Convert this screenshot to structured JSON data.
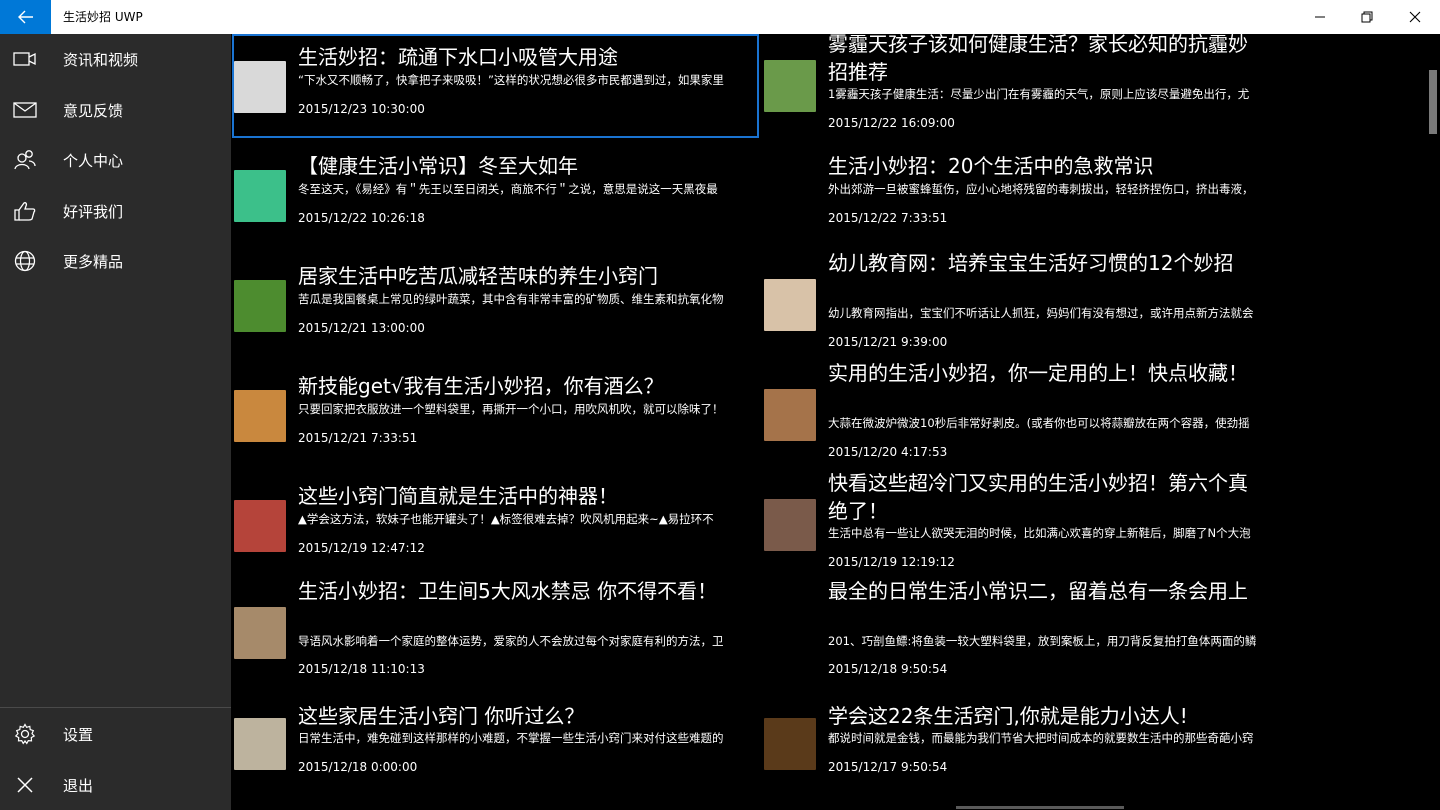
{
  "window": {
    "title": "生活妙招 UWP",
    "back_icon": "arrow-left-icon",
    "minimize_icon": "minimize-icon",
    "restore_icon": "restore-icon",
    "close_icon": "close-icon"
  },
  "sidebar": {
    "items": [
      {
        "label": "资讯和视频",
        "icon": "video-camera-icon"
      },
      {
        "label": "意见反馈",
        "icon": "mail-icon"
      },
      {
        "label": "个人中心",
        "icon": "people-icon"
      },
      {
        "label": "好评我们",
        "icon": "thumbs-up-icon"
      },
      {
        "label": "更多精品",
        "icon": "globe-icon"
      }
    ],
    "bottom_items": [
      {
        "label": "设置",
        "icon": "gear-icon"
      },
      {
        "label": "退出",
        "icon": "close-icon"
      }
    ]
  },
  "articles_left": [
    {
      "title": "生活妙招：疏通下水口小吸管大用途",
      "summary": "“下水又不顺畅了，快拿把子来吸吸！”这样的状况想必很多市民都遇到过，如果家里",
      "date": "2015/12/23 10:30:00",
      "thumb_color": "#d9d9d9"
    },
    {
      "title": "【健康生活小常识】冬至大如年",
      "summary": "冬至这天，《易经》有＂先王以至日闭关，商旅不行＂之说，意思是说这一天黑夜最",
      "date": "2015/12/22 10:26:18",
      "thumb_color": "#3cc08a"
    },
    {
      "title": "居家生活中吃苦瓜减轻苦味的养生小窍门",
      "summary": "苦瓜是我国餐桌上常见的绿叶蔬菜，其中含有非常丰富的矿物质、维生素和抗氧化物",
      "date": "2015/12/21 13:00:00",
      "thumb_color": "#4d8c2f"
    },
    {
      "title": "新技能get√我有生活小妙招，你有酒么？",
      "summary": "只要回家把衣服放进一个塑料袋里，再撕开一个小口，用吹风机吹，就可以除味了！",
      "date": "2015/12/21 7:33:51",
      "thumb_color": "#c9883e"
    },
    {
      "title": "这些小窍门简直就是生活中的神器！",
      "summary": "▲学会这方法，软妹子也能开罐头了！▲标签很难去掉？吹风机用起来~▲易拉环不",
      "date": "2015/12/19 12:47:12",
      "thumb_color": "#b5443a"
    },
    {
      "title": "生活小妙招：卫生间5大风水禁忌 你不得不看！",
      "summary": "导语风水影响着一个家庭的整体运势，爱家的人不会放过每个对家庭有利的方法，卫",
      "date": "2015/12/18 11:10:13",
      "thumb_color": "#a68a6a"
    },
    {
      "title": "这些家居生活小窍门 你听过么？",
      "summary": "日常生活中，难免碰到这样那样的小难题，不掌握一些生活小窍门来对付这些难题的",
      "date": "2015/12/18 0:00:00",
      "thumb_color": "#bdb39e"
    }
  ],
  "articles_right": [
    {
      "title": "雾霾天孩子该如何健康生活？家长必知的抗霾妙招推荐",
      "summary": "1雾霾天孩子健康生活：尽量少出门在有雾霾的天气，原则上应该尽量避免出行，尤",
      "date": "2015/12/22 16:09:00",
      "thumb_color": "#6a9a4a"
    },
    {
      "title": "生活小妙招：20个生活中的急救常识",
      "summary": "外出郊游一旦被蜜蜂蜇伤，应小心地将残留的毒刺拔出，轻轻挤捏伤口，挤出毒液，",
      "date": "2015/12/22 7:33:51",
      "thumb_color": "#000000"
    },
    {
      "title": "幼儿教育网：培养宝宝生活好习惯的12个妙招",
      "summary": "幼儿教育网指出，宝宝们不听话让人抓狂，妈妈们有没有想过，或许用点新方法就会",
      "date": "2015/12/21 9:39:00",
      "thumb_color": "#d8c2a8"
    },
    {
      "title": "实用的生活小妙招，你一定用的上！快点收藏！",
      "summary": "大蒜在微波炉微波10秒后非常好剥皮。(或者你也可以将蒜瓣放在两个容器，使劲摇",
      "date": "2015/12/20 4:17:53",
      "thumb_color": "#a5734a"
    },
    {
      "title": "快看这些超冷门又实用的生活小妙招！第六个真绝了！",
      "summary": "生活中总有一些让人欲哭无泪的时候，比如满心欢喜的穿上新鞋后，脚磨了N个大泡",
      "date": "2015/12/19 12:19:12",
      "thumb_color": "#7a5a4a"
    },
    {
      "title": "最全的日常生活小常识二，留着总有一条会用上",
      "summary": "201、巧剖鱼鳔:将鱼装一较大塑料袋里，放到案板上，用刀背反复拍打鱼体两面的鳞",
      "date": "2015/12/18 9:50:54",
      "thumb_color": "#000000"
    },
    {
      "title": "学会这22条生活窍门,你就是能力小达人!",
      "summary": "都说时间就是金钱，而最能为我们节省大把时间成本的就要数生活中的那些奇葩小窍",
      "date": "2015/12/17 9:50:54",
      "thumb_color": "#5a3a1a"
    }
  ]
}
